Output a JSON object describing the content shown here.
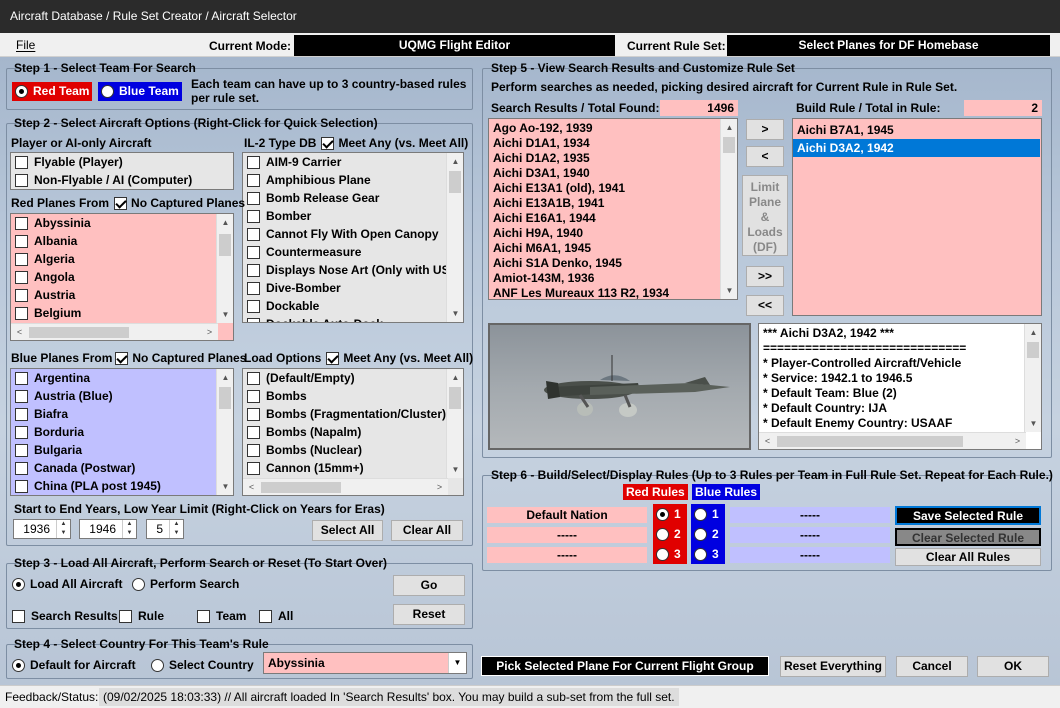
{
  "window": {
    "title": "Aircraft Database / Rule Set Creator / Aircraft Selector"
  },
  "menu": {
    "file": "File"
  },
  "header": {
    "mode_label": "Current Mode:",
    "mode_value": "UQMG Flight Editor",
    "ruleset_label": "Current Rule Set:",
    "ruleset_value": "Select Planes for DF Homebase"
  },
  "step1": {
    "title": "Step 1 - Select Team For Search",
    "red": "Red Team",
    "blue": "Blue Team",
    "note": "Each team can have up to 3 country-based rules per rule set."
  },
  "step2": {
    "title": "Step 2 - Select Aircraft Options (Right-Click for Quick Selection)",
    "player_label": "Player or AI-only Aircraft",
    "player_items": [
      "Flyable (Player)",
      "Non-Flyable / AI (Computer)"
    ],
    "il2_label": "IL-2 Type DB",
    "meet_any": "Meet Any (vs. Meet All)",
    "il2_items": [
      "AIM-9 Carrier",
      "Amphibious Plane",
      "Bomb Release Gear",
      "Bomber",
      "Cannot Fly With Open Canopy",
      "Countermeasure",
      "Displays Nose Art (Only with USA",
      "Dive-Bomber",
      "Dockable",
      "Dockable Auto-Dock"
    ],
    "red_label": "Red Planes From",
    "no_captured": "No Captured Planes",
    "red_items": [
      "Abyssinia",
      "Albania",
      "Algeria",
      "Angola",
      "Austria",
      "Belgium"
    ],
    "blue_label": "Blue Planes From",
    "blue_items": [
      "Argentina",
      "Austria (Blue)",
      "Biafra",
      "Borduria",
      "Bulgaria",
      "Canada (Postwar)",
      "China (PLA post 1945)"
    ],
    "load_label": "Load Options",
    "load_items": [
      "(Default/Empty)",
      "Bombs",
      "Bombs (Fragmentation/Cluster)",
      "Bombs (Napalm)",
      "Bombs (Nuclear)",
      "Cannon (15mm+)"
    ],
    "years_label": "Start to End Years, Low Year Limit (Right-Click on Years for Eras)",
    "start_year": "1936",
    "end_year": "1946",
    "low_limit": "5",
    "select_all": "Select All",
    "clear_all": "Clear All"
  },
  "step3": {
    "title": "Step 3 - Load All Aircraft, Perform Search or Reset (To Start Over)",
    "load_all": "Load All Aircraft",
    "perform_search": "Perform Search",
    "go": "Go",
    "reset": "Reset",
    "search_results": "Search Results",
    "rule": "Rule",
    "team": "Team",
    "all": "All"
  },
  "step4": {
    "title": "Step 4 - Select Country For This Team's Rule",
    "default": "Default for Aircraft",
    "select_country": "Select Country",
    "country": "Abyssinia"
  },
  "step5": {
    "title": "Step 5 - View Search Results and Customize Rule Set",
    "desc": "Perform searches as needed, picking desired aircraft for Current Rule in Rule Set.",
    "results_label": "Search Results / Total Found:",
    "results_total": "1496",
    "results": [
      "Ago Ao-192, 1939",
      "Aichi D1A1, 1934",
      "Aichi D1A2, 1935",
      "Aichi D3A1, 1940",
      "Aichi E13A1 (old), 1941",
      "Aichi E13A1B, 1941",
      "Aichi E16A1, 1944",
      "Aichi H9A, 1940",
      "Aichi M6A1, 1945",
      "Aichi S1A Denko, 1945",
      "Amiot-143M, 1936",
      "ANF Les Mureaux 113 R2, 1934"
    ],
    "build_label": "Build Rule / Total in Rule:",
    "build_total": "2",
    "build_items": [
      "Aichi B7A1, 1945",
      "Aichi D3A2, 1942"
    ],
    "add": ">",
    "remove": "<",
    "limit": [
      "Limit",
      "Plane",
      "&",
      "Loads",
      "(DF)"
    ],
    "add_all": ">>",
    "remove_all": "<<",
    "info_lines": [
      "*** Aichi D3A2, 1942 ***",
      "=============================",
      "* Player-Controlled Aircraft/Vehicle",
      "* Service: 1942.1 to 1946.5",
      "* Default Team: Blue (2)",
      "* Default Country: IJA",
      "* Default Enemy Country: USAAF"
    ]
  },
  "step6": {
    "title": "Step 6 - Build/Select/Display Rules (Up to 3 Rules per Team in Full Rule Set.  Repeat for Each Rule.)",
    "red_rules": "Red Rules",
    "blue_rules": "Blue Rules",
    "red_fields": [
      "Default Nation",
      "-----",
      "-----"
    ],
    "blue_fields": [
      "-----",
      "-----",
      "-----"
    ],
    "nums": [
      "1",
      "2",
      "3"
    ],
    "save": "Save Selected Rule",
    "clear_sel": "Clear Selected Rule",
    "clear_all": "Clear All Rules"
  },
  "bottom": {
    "pick": "Pick Selected Plane For Current Flight Group",
    "reset_everything": "Reset Everything",
    "cancel": "Cancel",
    "ok": "OK"
  },
  "status": {
    "label": "Feedback/Status:",
    "text": "(09/02/2025 18:03:33) // All aircraft loaded In 'Search Results' box. You may build a sub-set from the full set."
  },
  "colors": {
    "red": "#e00000",
    "blue": "#0000e0",
    "pink": "#ffc0c0",
    "lavender": "#c0c0ff",
    "select": "#0078d7"
  }
}
